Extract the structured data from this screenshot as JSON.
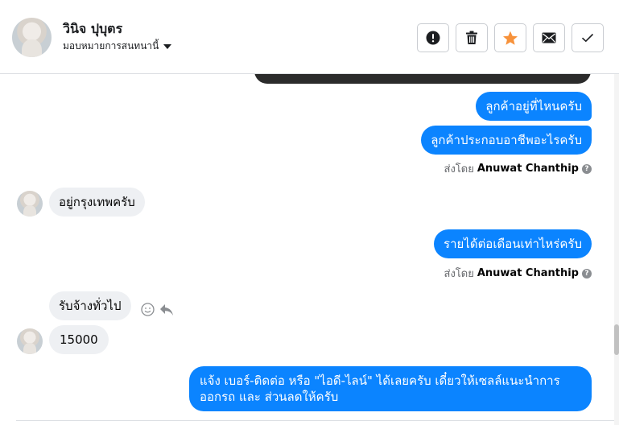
{
  "header": {
    "contact_name": "วินิจ ปุบุตร",
    "assign_label": "มอบหมายการสนทนานี้",
    "actions": [
      {
        "name": "report",
        "icon": "alert-circle-icon"
      },
      {
        "name": "delete",
        "icon": "trash-icon"
      },
      {
        "name": "star",
        "icon": "star-icon",
        "color": "#f7923b"
      },
      {
        "name": "email",
        "icon": "envelope-icon"
      },
      {
        "name": "done",
        "icon": "checkmark-icon"
      }
    ]
  },
  "messages": {
    "m1": "ลูกค้าอยู่ที่ไหนครับ",
    "m2": "ลูกค้าประกอบอาชีพอะไรครับ",
    "sent_by_1": {
      "prefix": "ส่งโดย",
      "name": "Anuwat Chanthip"
    },
    "m3": "อยู่กรุงเทพครับ",
    "m4": "รายได้ต่อเดือนเท่าไหร่ครับ",
    "sent_by_2": {
      "prefix": "ส่งโดย",
      "name": "Anuwat Chanthip"
    },
    "m5": "รับจ้างทั่วไป",
    "m6": "15000",
    "m7_line1": "แจ้ง เบอร์-ติดต่อ หรือ \"ไอดี-ไลน์\" ได้เลยครับ เดี๋ยวให้เซลล์แนะนำการ",
    "m7_line2": "ออกรถ และ ส่วนลดให้ครับ"
  },
  "colors": {
    "outgoing_bubble": "#0b84ff",
    "incoming_bubble": "#eef0f3",
    "star": "#f7923b"
  }
}
